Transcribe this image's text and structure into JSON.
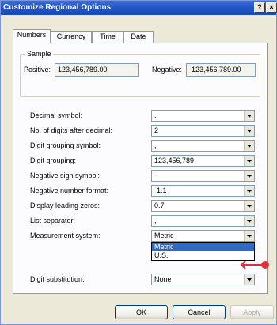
{
  "window": {
    "title": "Customize Regional Options",
    "help_label": "?",
    "close_label": "×"
  },
  "tabs": [
    {
      "label": "Numbers",
      "active": true
    },
    {
      "label": "Currency",
      "active": false
    },
    {
      "label": "Time",
      "active": false
    },
    {
      "label": "Date",
      "active": false
    }
  ],
  "sample": {
    "label": "Sample",
    "positive_label": "Positive:",
    "positive_value": "123,456,789.00",
    "negative_label": "Negative:",
    "negative_value": "-123,456,789.00"
  },
  "settings": [
    {
      "label": "Decimal symbol:",
      "value": "."
    },
    {
      "label": "No. of digits after decimal:",
      "value": "2"
    },
    {
      "label": "Digit grouping symbol:",
      "value": ","
    },
    {
      "label": "Digit grouping:",
      "value": "123,456,789"
    },
    {
      "label": "Negative sign symbol:",
      "value": "-"
    },
    {
      "label": "Negative number format:",
      "value": "-1.1"
    },
    {
      "label": "Display leading zeros:",
      "value": "0.7"
    },
    {
      "label": "List separator:",
      "value": ","
    },
    {
      "label": "Measurement system:",
      "value": "Metric"
    },
    {
      "label": "Digit substitution:",
      "value": "None"
    }
  ],
  "measurement_dropdown": {
    "options": [
      "Metric",
      "U.S."
    ],
    "selected": "Metric"
  },
  "colors": {
    "titlebar": "#2458c7",
    "selection": "#316ac5",
    "pointer": "#e0303a"
  },
  "buttons": {
    "ok": "OK",
    "cancel": "Cancel",
    "apply": "Apply"
  }
}
